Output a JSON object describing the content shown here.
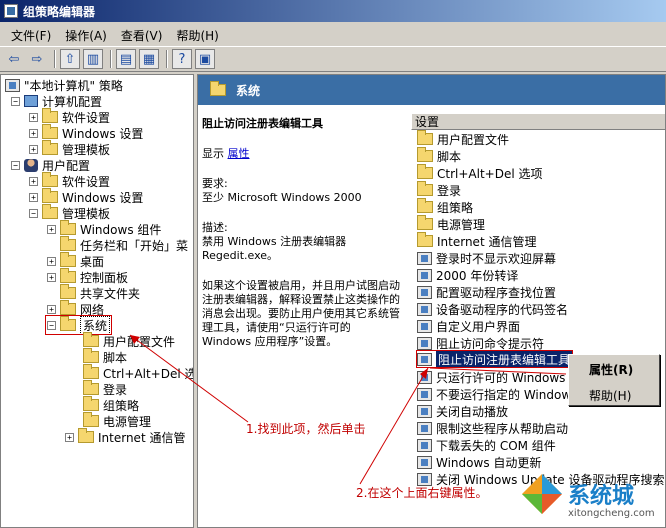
{
  "window": {
    "title": "组策略编辑器"
  },
  "menu": [
    "文件(F)",
    "操作(A)",
    "查看(V)",
    "帮助(H)"
  ],
  "tree": {
    "root": "\"本地计算机\" 策略",
    "computer": "计算机配置",
    "computer_children": [
      "软件设置",
      "Windows 设置",
      "管理模板"
    ],
    "user": "用户配置",
    "user_children": [
      "软件设置",
      "Windows 设置",
      "管理模板"
    ],
    "admin_children": [
      "Windows 组件",
      "任务栏和「开始」菜",
      "桌面",
      "控制面板",
      "共享文件夹",
      "网络",
      "系统"
    ],
    "system_children": [
      "用户配置文件",
      "脚本",
      "Ctrl+Alt+Del 选",
      "登录",
      "组策略",
      "电源管理",
      "Internet 通信管"
    ]
  },
  "detail": {
    "header": "系统",
    "policy_title": "阻止访问注册表编辑工具",
    "display_label": "显示",
    "properties_link": "属性",
    "requirements_label": "要求:",
    "requirements_value": "至少 Microsoft Windows 2000",
    "description_label": "描述:",
    "description_line1": "禁用 Windows 注册表编辑器",
    "description_line2": "Regedit.exe。",
    "para1": "如果这个设置被启用，并且用户试图启动注册表编辑器，解释设置禁止这类操作的消息会出现。要防止用户使用其它系统管理工具，请使用“只运行许可的 Windows 应用程序”设置。"
  },
  "list": {
    "column": "设置",
    "folders": [
      "用户配置文件",
      "脚本",
      "Ctrl+Alt+Del 选项",
      "登录",
      "组策略",
      "电源管理",
      "Internet 通信管理"
    ],
    "policies": [
      "登录时不显示欢迎屏幕",
      "2000 年份转译",
      "配置驱动程序查找位置",
      "设备驱动程序的代码签名",
      "自定义用户界面",
      "阻止访问命令提示符",
      "阻止访问注册表编辑工具",
      "只运行许可的 Windows 应",
      "不要运行指定的 Windows",
      "关闭自动播放",
      "限制这些程序从帮助启动",
      "下载丢失的 COM 组件",
      "Windows 自动更新",
      "关闭 Windows Update 设备驱动程序搜索提"
    ]
  },
  "context_menu": {
    "properties": "属性(R)",
    "help": "帮助(H)"
  },
  "annotations": {
    "step1": "1.找到此项，然后单击",
    "step2": "2.在这个上面右键属性。"
  },
  "watermark": {
    "name": "系统城",
    "url": "xitongcheng.com"
  },
  "colors": {
    "title_start": "#0a246a",
    "selection": "#0a246a",
    "header": "#3a6ea5",
    "annotation": "#c00000"
  }
}
